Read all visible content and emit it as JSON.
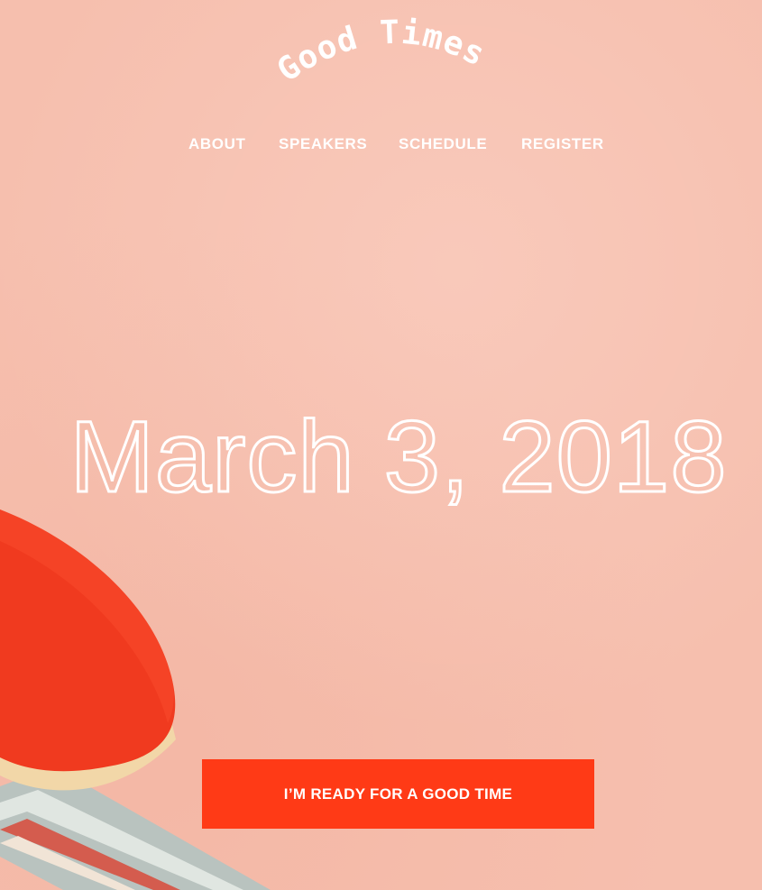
{
  "brand": {
    "logo_text": "Good Times"
  },
  "nav": {
    "items": [
      {
        "label": "ABOUT"
      },
      {
        "label": "SPEAKERS"
      },
      {
        "label": "SCHEDULE"
      },
      {
        "label": "REGISTER"
      }
    ]
  },
  "hero": {
    "date": "March 3, 2018",
    "cta_label": "I’M READY FOR A GOOD TIME"
  },
  "colors": {
    "background": "#f6bfae",
    "cta": "#ff3a16",
    "text": "#ffffff",
    "paddle_rubber": "#f03a1f"
  },
  "icons": {
    "hero_image": "ping-pong-paddle"
  }
}
